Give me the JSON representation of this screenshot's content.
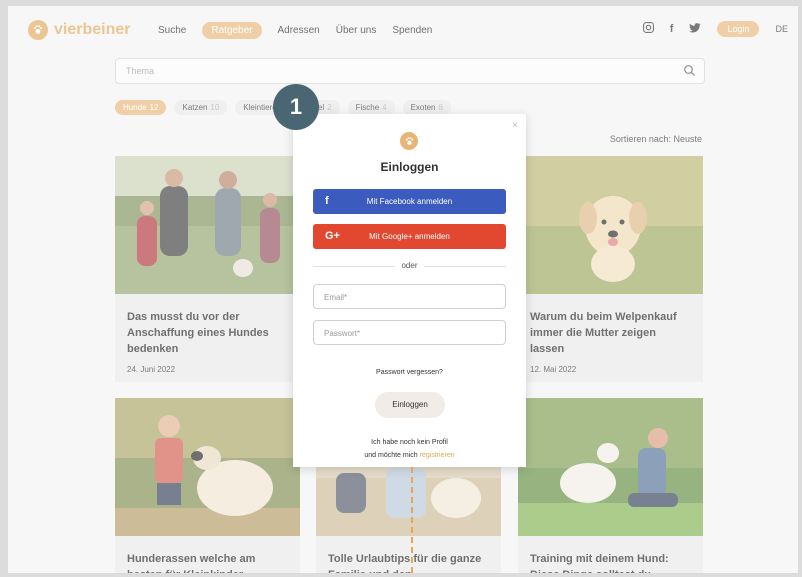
{
  "header": {
    "logo_text": "vierbeiner",
    "nav": [
      "Suche",
      "Ratgeber",
      "Adressen",
      "Über uns",
      "Spenden"
    ],
    "active_nav_index": 1,
    "login_label": "Login",
    "lang": "DE"
  },
  "search": {
    "placeholder": "Thema"
  },
  "filters": [
    {
      "label": "Hunde",
      "count": "12",
      "active": true
    },
    {
      "label": "Katzen",
      "count": "10",
      "active": false
    },
    {
      "label": "Kleintiere",
      "count": "",
      "active": false
    },
    {
      "label": "Vögel",
      "count": "2",
      "active": false
    },
    {
      "label": "Fische",
      "count": "4",
      "active": false
    },
    {
      "label": "Exoten",
      "count": "8",
      "active": false
    }
  ],
  "sort": {
    "label": "Sortieren nach:",
    "value": "Neuste"
  },
  "cards": [
    {
      "title": "Das musst du vor der Anschaffung eines Hundes bedenken",
      "date": "24. Juni 2022"
    },
    {
      "title": "Warum du beim Welpenkauf immer die Mutter zeigen lassen",
      "date": "12. Mai 2022"
    },
    {
      "title": "Hunderassen welche am besten für Kleinkinder",
      "date": ""
    },
    {
      "title": "Tolle Urlaubtips für die ganze Familie und den",
      "date": ""
    },
    {
      "title": "Training mit deinem Hund: Diese Dinge solltest du",
      "date": ""
    }
  ],
  "modal": {
    "title": "Einloggen",
    "facebook_label": "Mit Facebook anmelden",
    "google_label": "Mit Google+ anmelden",
    "divider": "oder",
    "email_placeholder": "Email*",
    "password_placeholder": "Passwort*",
    "forgot": "Passwort vergessen?",
    "submit": "Einloggen",
    "foot_line1": "Ich habe noch kein Profil",
    "foot_line2_prefix": "und möchte mich ",
    "foot_link": "registrieren",
    "close": "×"
  },
  "annotation_badge": "1",
  "colors": {
    "accent": "#e8b577",
    "facebook": "#3b5bbf",
    "google": "#e2472f",
    "badge": "#4a6672"
  }
}
